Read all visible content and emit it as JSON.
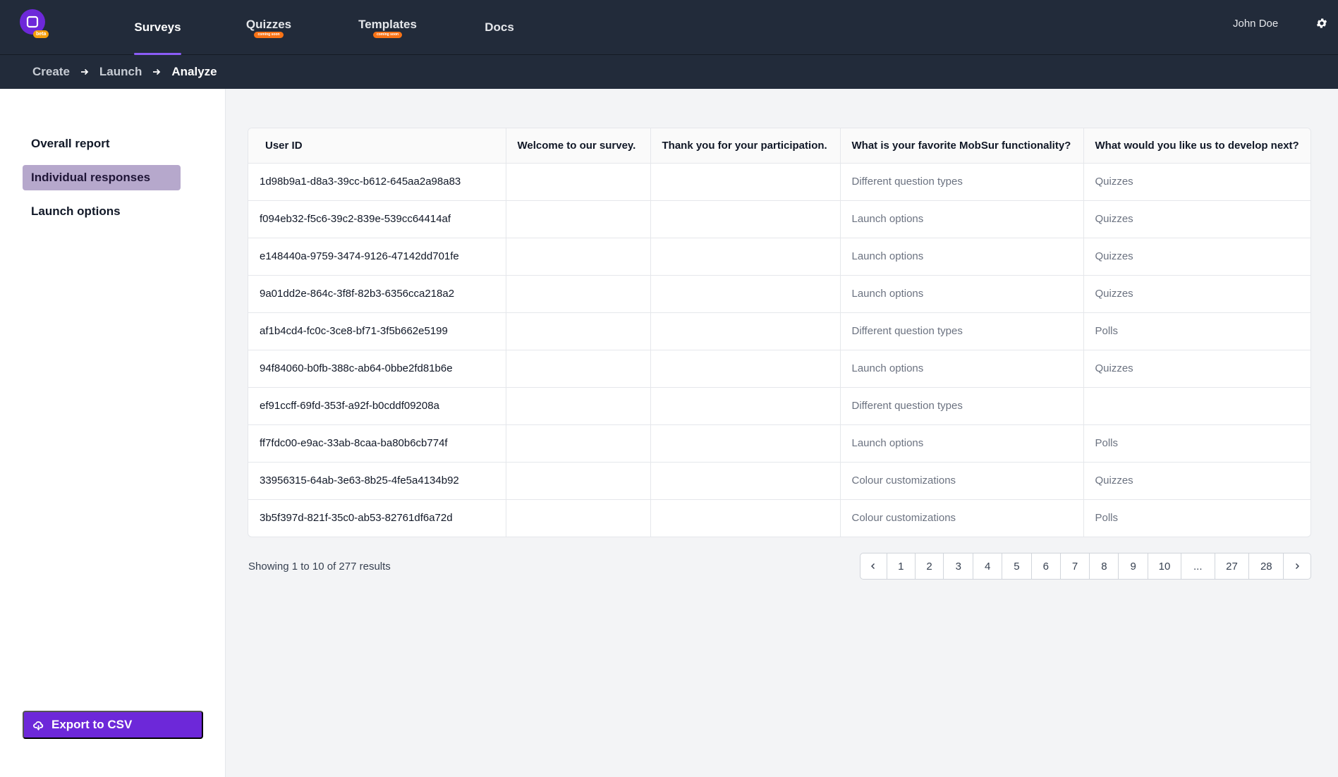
{
  "app": {
    "beta_badge": "beta",
    "user_name": "John Doe",
    "accent_color": "#6d28d9"
  },
  "nav": {
    "tabs": [
      {
        "label": "Surveys",
        "badge": ""
      },
      {
        "label": "Quizzes",
        "badge": "coming soon"
      },
      {
        "label": "Templates",
        "badge": "coming soon"
      },
      {
        "label": "Docs",
        "badge": ""
      }
    ]
  },
  "breadcrumb": [
    "Create",
    "Launch",
    "Analyze"
  ],
  "sidebar": {
    "items": [
      "Overall report",
      "Individual responses",
      "Launch options"
    ],
    "export_label": "Export to CSV"
  },
  "table": {
    "headers": [
      "User ID",
      "Welcome to our survey.",
      "Thank you for your participation.",
      "What is your favorite MobSur functionality?",
      "What would you like us to develop next?"
    ],
    "rows": [
      [
        "1d98b9a1-d8a3-39cc-b612-645aa2a98a83",
        "",
        "",
        "Different question types",
        "Quizzes"
      ],
      [
        "f094eb32-f5c6-39c2-839e-539cc64414af",
        "",
        "",
        "Launch options",
        "Quizzes"
      ],
      [
        "e148440a-9759-3474-9126-47142dd701fe",
        "",
        "",
        "Launch options",
        "Quizzes"
      ],
      [
        "9a01dd2e-864c-3f8f-82b3-6356cca218a2",
        "",
        "",
        "Launch options",
        "Quizzes"
      ],
      [
        "af1b4cd4-fc0c-3ce8-bf71-3f5b662e5199",
        "",
        "",
        "Different question types",
        "Polls"
      ],
      [
        "94f84060-b0fb-388c-ab64-0bbe2fd81b6e",
        "",
        "",
        "Launch options",
        "Quizzes"
      ],
      [
        "ef91ccff-69fd-353f-a92f-b0cddf09208a",
        "",
        "",
        "Different question types",
        ""
      ],
      [
        "ff7fdc00-e9ac-33ab-8caa-ba80b6cb774f",
        "",
        "",
        "Launch options",
        "Polls"
      ],
      [
        "33956315-64ab-3e63-8b25-4fe5a4134b92",
        "",
        "",
        "Colour customizations",
        "Quizzes"
      ],
      [
        "3b5f397d-821f-35c0-ab53-82761df6a72d",
        "",
        "",
        "Colour customizations",
        "Polls"
      ]
    ]
  },
  "pagination": {
    "showing_text": "Showing 1 to 10 of 277 results",
    "pages": [
      "1",
      "2",
      "3",
      "4",
      "5",
      "6",
      "7",
      "8",
      "9",
      "10",
      "...",
      "27",
      "28"
    ]
  }
}
